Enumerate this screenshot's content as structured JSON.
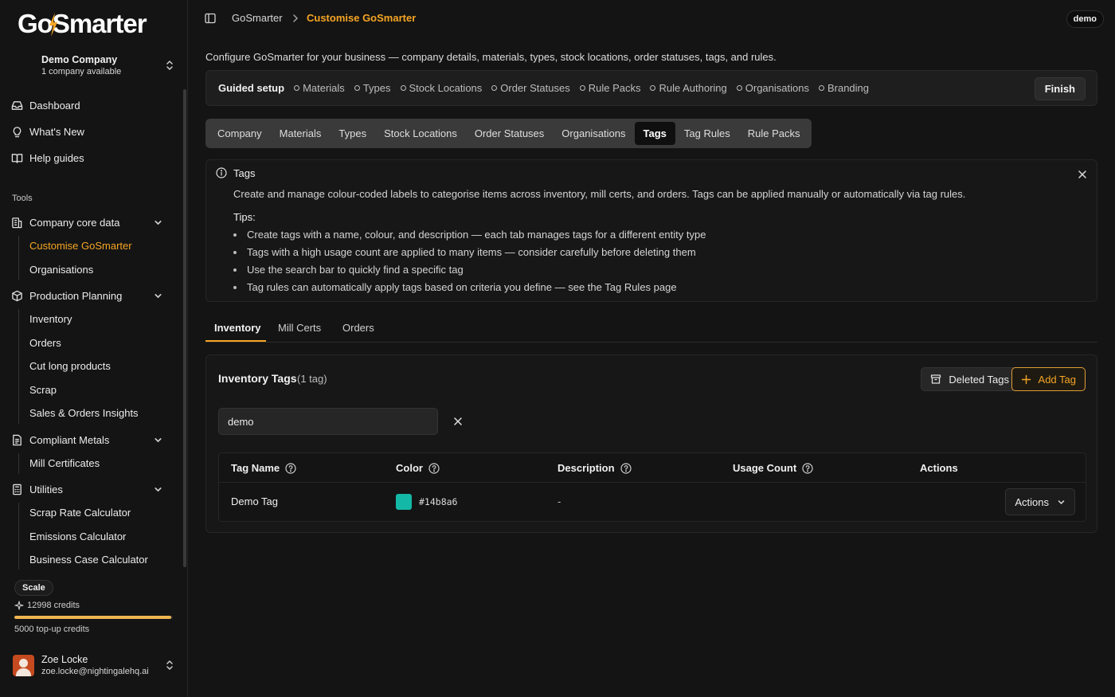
{
  "app": {
    "logo_left": "Go",
    "logo_o": "S",
    "logo_right": "marter"
  },
  "company": {
    "name": "Demo Company",
    "sub": "1 company available"
  },
  "nav": {
    "dashboard": "Dashboard",
    "whats_new": "What's New",
    "help_guides": "Help guides",
    "tools_label": "Tools",
    "company_core_data": "Company core data",
    "customise": "Customise GoSmarter",
    "organisations": "Organisations",
    "production_planning": "Production Planning",
    "inventory": "Inventory",
    "orders": "Orders",
    "cut_long_products": "Cut long products",
    "scrap": "Scrap",
    "sales_insights": "Sales & Orders Insights",
    "compliant_metals": "Compliant Metals",
    "mill_certificates": "Mill Certificates",
    "utilities": "Utilities",
    "scrap_rate_calc": "Scrap Rate Calculator",
    "emissions_calc": "Emissions Calculator",
    "business_case_calc": "Business Case Calculator"
  },
  "plan": {
    "badge": "Scale",
    "credits": "12998 credits",
    "credits_fraction": 0.99,
    "topup": "5000 top-up credits"
  },
  "user": {
    "name": "Zoe Locke",
    "email": "zoe.locke@nightingalehq.ai"
  },
  "breadcrumb": {
    "root": "GoSmarter",
    "current": "Customise GoSmarter"
  },
  "env_badge": "demo",
  "description": "Configure GoSmarter for your business — company details, materials, types, stock locations, order statuses, tags, and rules.",
  "guided_setup": {
    "title": "Guided setup",
    "steps": [
      "Materials",
      "Types",
      "Stock Locations",
      "Order Statuses",
      "Rule Packs",
      "Rule Authoring",
      "Organisations",
      "Branding"
    ],
    "finish": "Finish"
  },
  "section_tabs": [
    "Company",
    "Materials",
    "Types",
    "Stock Locations",
    "Order Statuses",
    "Organisations",
    "Tags",
    "Tag Rules",
    "Rule Packs"
  ],
  "info": {
    "title": "Tags",
    "desc": "Create and manage colour-coded labels to categorise items across inventory, mill certs, and orders. Tags can be applied manually or automatically via tag rules.",
    "tips_title": "Tips:",
    "tips": [
      "Create tags with a name, colour, and description — each tab manages tags for a different entity type",
      "Tags with a high usage count are applied to many items — consider carefully before deleting them",
      "Use the search bar to quickly find a specific tag",
      "Tag rules can automatically apply tags based on criteria you define — see the Tag Rules page"
    ]
  },
  "entity_tabs": [
    "Inventory",
    "Mill Certs",
    "Orders"
  ],
  "tags_card": {
    "title": "Inventory Tags",
    "count": "(1 tag)",
    "deleted_btn": "Deleted Tags",
    "add_btn": "Add Tag",
    "search_value": "demo",
    "columns": [
      "Tag Name",
      "Color",
      "Description",
      "Usage Count",
      "Actions"
    ],
    "rows": [
      {
        "name": "Demo Tag",
        "color": "#14b8a6",
        "description": "-",
        "usage": "",
        "actions": "Actions"
      }
    ]
  },
  "colors": {
    "accent": "#f5a524",
    "tag_swatch": "#14b8a6"
  }
}
